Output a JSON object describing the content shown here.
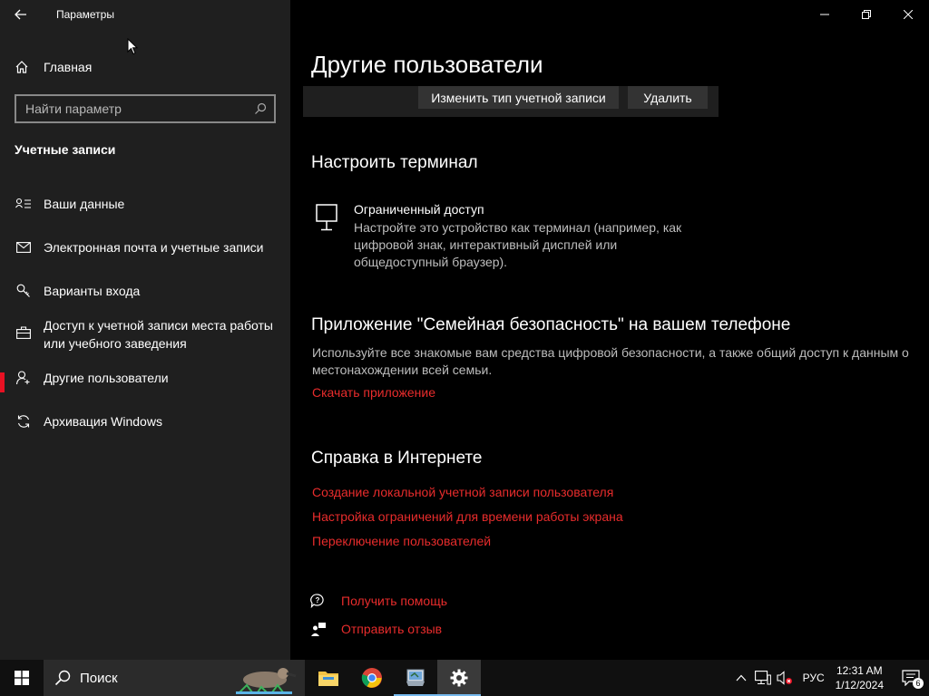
{
  "window": {
    "title": "Параметры"
  },
  "sidebar": {
    "home_label": "Главная",
    "search_placeholder": "Найти параметр",
    "section_title": "Учетные записи",
    "items": [
      {
        "label": "Ваши данные",
        "icon": "person-card-icon"
      },
      {
        "label": "Электронная почта и учетные записи",
        "icon": "mail-icon"
      },
      {
        "label": "Варианты входа",
        "icon": "key-icon"
      },
      {
        "label": "Доступ к учетной записи места работы или учебного заведения",
        "icon": "briefcase-icon"
      },
      {
        "label": "Другие пользователи",
        "icon": "person-add-icon",
        "active": true
      },
      {
        "label": "Архивация Windows",
        "icon": "sync-icon"
      }
    ]
  },
  "main": {
    "title": "Другие пользователи",
    "change_type_button": "Изменить тип учетной записи",
    "delete_button": "Удалить",
    "kiosk": {
      "heading": "Настроить терминал",
      "title": "Ограниченный доступ",
      "description": "Настройте это устройство как терминал (например, как цифровой знак, интерактивный дисплей или общедоступный браузер)."
    },
    "family": {
      "heading": "Приложение \"Семейная безопасность\" на вашем телефоне",
      "description": "Используйте все знакомые вам средства цифровой безопасности, а также общий доступ к данным о местонахождении всей семьи.",
      "link": "Скачать приложение"
    },
    "help": {
      "heading": "Справка в Интернете",
      "links": [
        "Создание локальной учетной записи пользователя",
        "Настройка ограничений для времени работы экрана",
        "Переключение пользователей"
      ]
    },
    "get_help": "Получить помощь",
    "feedback": "Отправить отзыв"
  },
  "taskbar": {
    "search_label": "Поиск",
    "language": "РУС",
    "time": "12:31 AM",
    "date": "1/12/2024",
    "notification_count": "6"
  },
  "colors": {
    "accent": "#e81123",
    "link": "#e82c2c",
    "sidebar_bg": "#1f1f1f"
  }
}
